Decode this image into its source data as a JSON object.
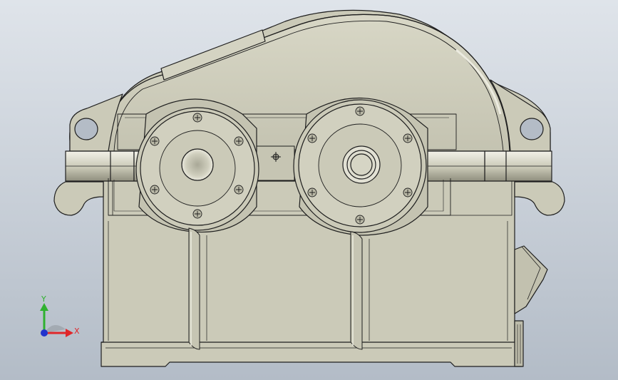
{
  "viewport": {
    "background_top": "#dfe4ea",
    "background_bottom": "#b3bcc7"
  },
  "model": {
    "name_icon": "gearbox-housing-model",
    "body_color": "#cbcab8",
    "body_shade": "#b9b8a6",
    "edge_color": "#1e1e1e",
    "highlight_color": "#ecebe0"
  },
  "triad": {
    "x_label": "X",
    "y_label": "Y",
    "x_color": "#e0262a",
    "y_color": "#2fb12f",
    "z_color": "#2233cc"
  }
}
